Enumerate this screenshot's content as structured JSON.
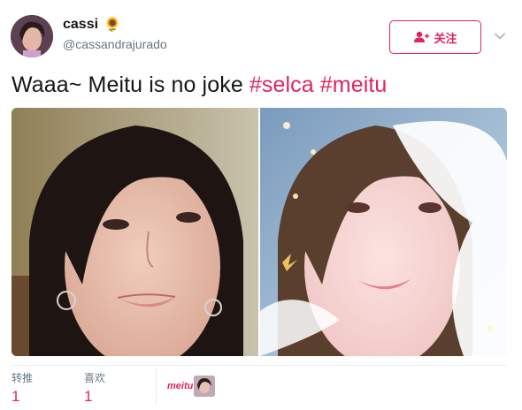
{
  "author": {
    "name": "cassi",
    "emoji": "🌻",
    "handle": "@cassandrajurado"
  },
  "follow_button": {
    "label": "关注",
    "icon": "add-user-icon"
  },
  "tweet": {
    "text_plain": "Waaa~ Meitu is no joke ",
    "hashtags": [
      "#selca",
      "#meitu"
    ]
  },
  "stats": {
    "retweets_label": "转推",
    "retweets_count": "1",
    "likes_label": "喜欢",
    "likes_count": "1"
  },
  "footer": {
    "source_logo": "meitu"
  },
  "colors": {
    "accent": "#e0245e",
    "text": "#14171a",
    "muted": "#657786"
  }
}
